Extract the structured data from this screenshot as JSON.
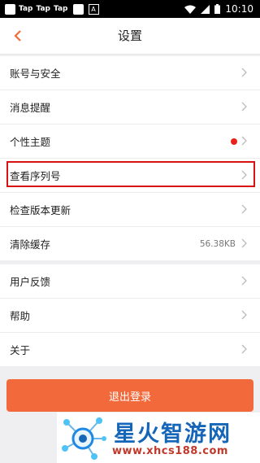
{
  "status_bar": {
    "apps": [
      "Tap",
      "Tap",
      "Tap"
    ],
    "app_badge": "A",
    "time": "10:10"
  },
  "header": {
    "title": "设置",
    "back_icon": "chevron-left-icon",
    "accent_color": "#f26a3b"
  },
  "groups": [
    {
      "items": [
        {
          "label": "账号与安全"
        },
        {
          "label": "消息提醒"
        },
        {
          "label": "个性主题",
          "has_red_dot": true
        },
        {
          "label": "查看序列号",
          "highlighted": true
        },
        {
          "label": "检查版本更新"
        },
        {
          "label": "清除缓存",
          "value": "56.38KB"
        }
      ]
    },
    {
      "items": [
        {
          "label": "用户反馈"
        },
        {
          "label": "帮助"
        },
        {
          "label": "关于"
        }
      ]
    }
  ],
  "logout_label": "退出登录",
  "watermark": {
    "brand": "星火智游网",
    "url": "www.xhcs188.com"
  },
  "colors": {
    "logout_bg": "#f26a3b",
    "highlight_border": "#d81111",
    "red_dot": "#e8221b"
  }
}
